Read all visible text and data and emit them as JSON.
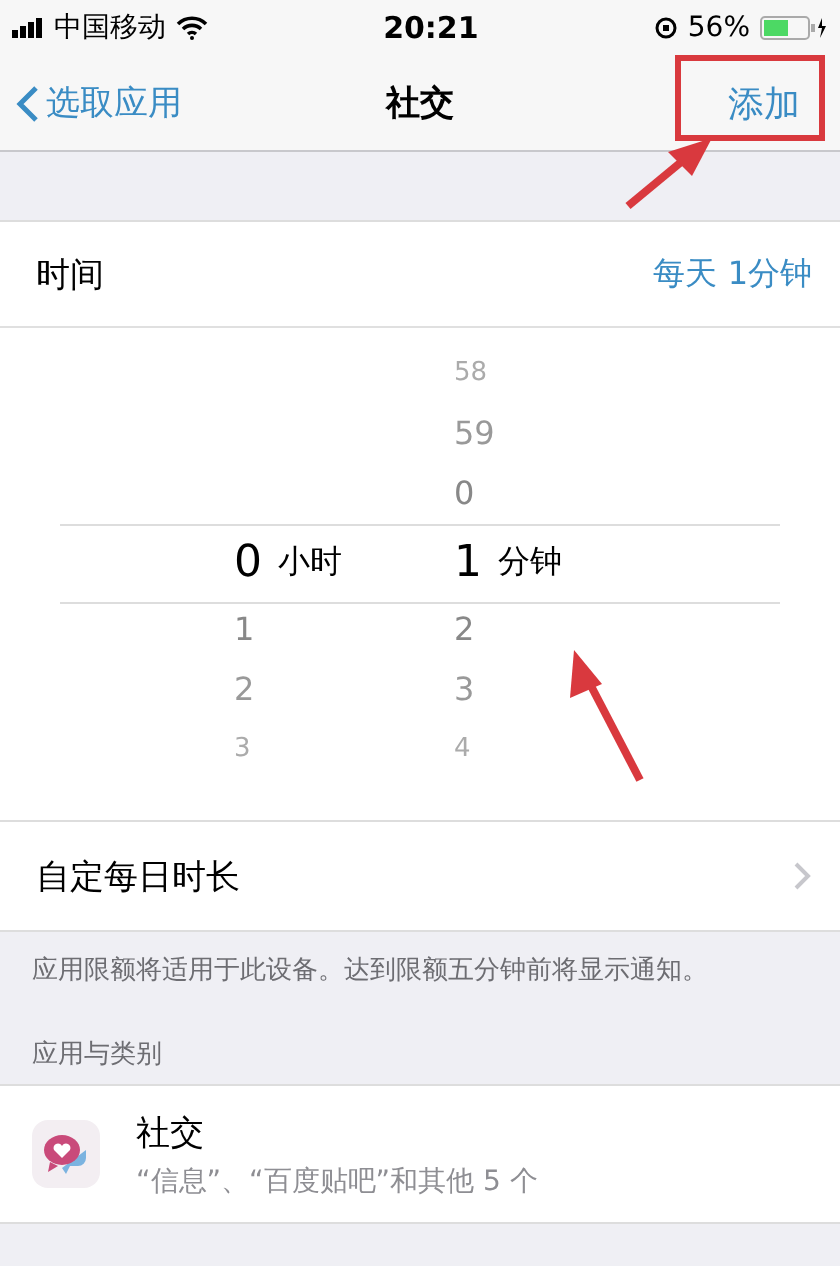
{
  "status_bar": {
    "carrier": "中国移动",
    "time": "20:21",
    "battery_percent": "56%"
  },
  "nav": {
    "back_label": "选取应用",
    "title": "社交",
    "action": "添加"
  },
  "time_row": {
    "label": "时间",
    "value": "每天 1分钟"
  },
  "picker": {
    "columns": [
      {
        "unit": "小时",
        "selected": "0",
        "below": [
          "1",
          "2",
          "3"
        ]
      },
      {
        "unit": "分钟",
        "above": [
          "58",
          "59",
          "0"
        ],
        "selected": "1",
        "below": [
          "2",
          "3",
          "4"
        ]
      }
    ]
  },
  "custom_row": {
    "label": "自定每日时长"
  },
  "footer_note": "应用限额将适用于此设备。达到限额五分钟前将显示通知。",
  "section_header": "应用与类别",
  "apps": [
    {
      "name": "社交",
      "detail": "“信息”、“百度贴吧”和其他 5 个"
    }
  ]
}
